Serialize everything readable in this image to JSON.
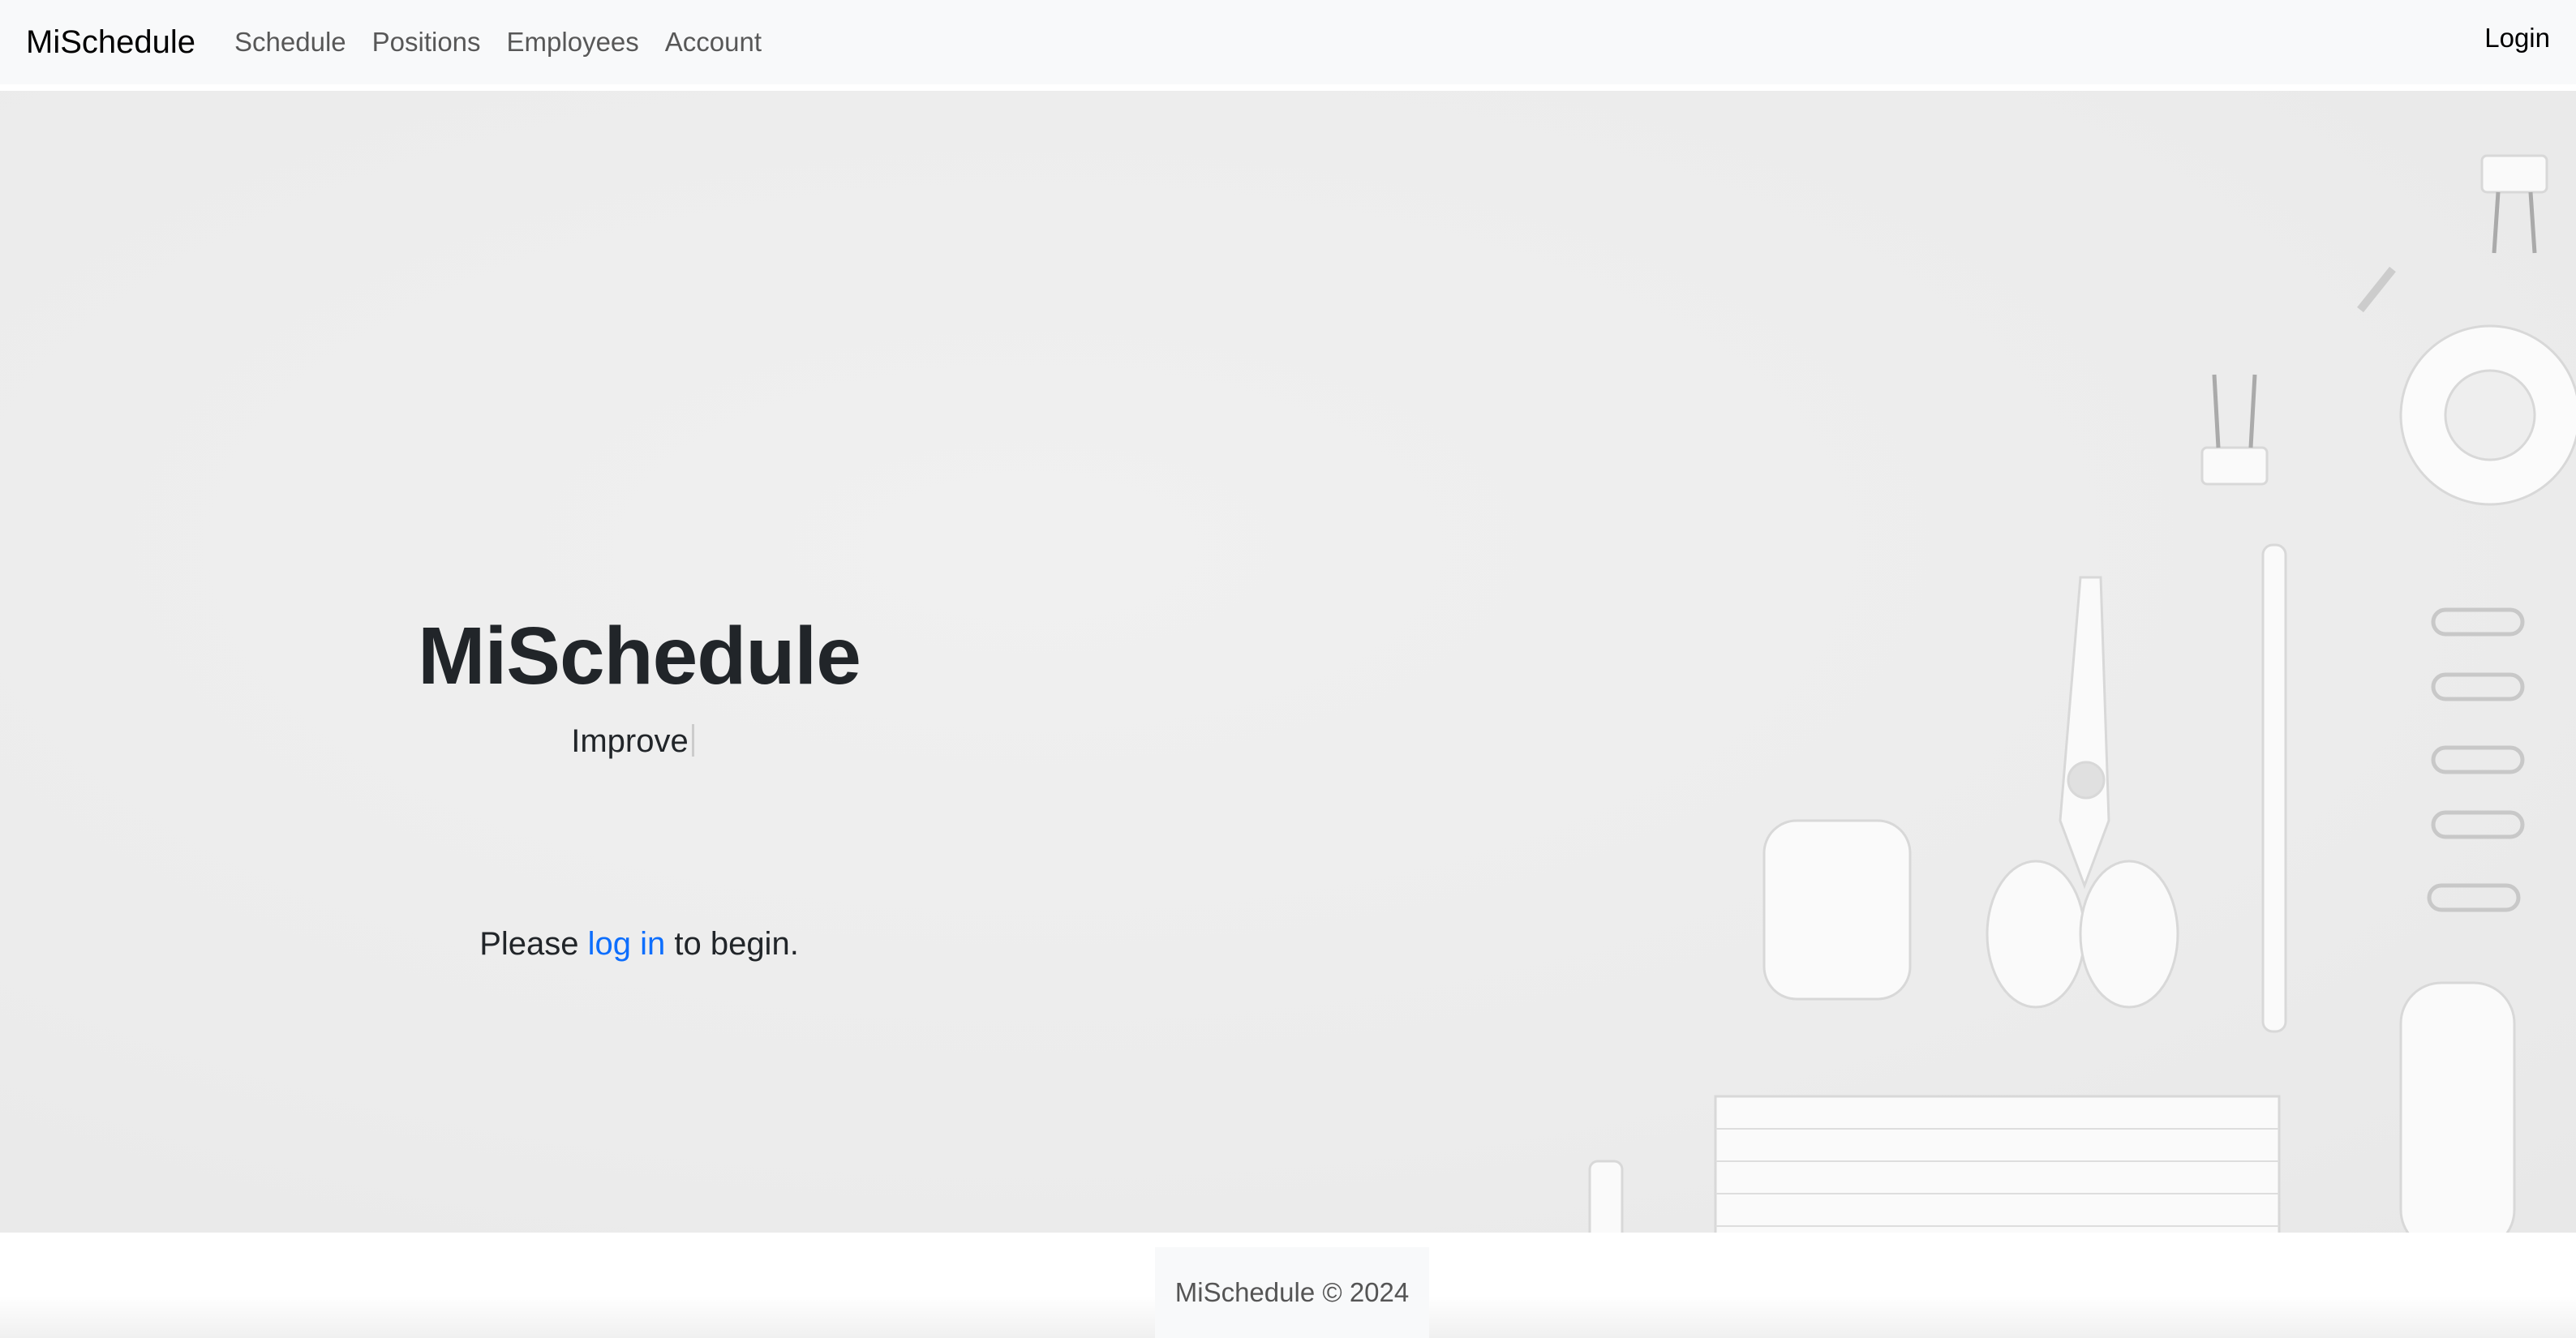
{
  "navbar": {
    "brand": "MiSchedule",
    "links": [
      "Schedule",
      "Positions",
      "Employees",
      "Account"
    ],
    "login": "Login"
  },
  "hero": {
    "title": "MiSchedule",
    "subtitle": "Improve",
    "prompt_before": "Please ",
    "prompt_link": "log in",
    "prompt_after": " to begin."
  },
  "footer": {
    "text": "MiSchedule © 2024"
  },
  "colors": {
    "link": "#0d6efd",
    "text": "#212529"
  }
}
